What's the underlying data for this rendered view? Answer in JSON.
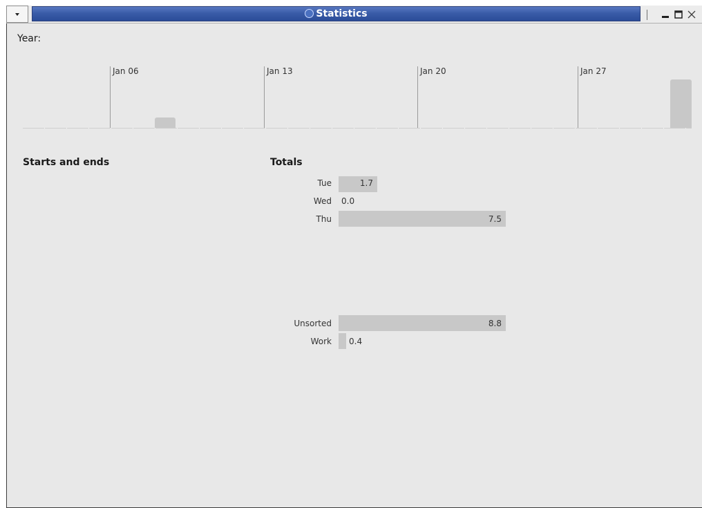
{
  "window": {
    "title": "Statistics"
  },
  "year": {
    "label": "Year:"
  },
  "timeline": {
    "weeks": [
      "Jan 06",
      "Jan 13",
      "Jan 20",
      "Jan 27"
    ]
  },
  "sections": {
    "starts_ends": "Starts and ends",
    "totals": "Totals"
  },
  "totals_days": [
    {
      "label": "Tue",
      "value": "1.7"
    },
    {
      "label": "Wed",
      "value": "0.0"
    },
    {
      "label": "Thu",
      "value": "7.5"
    }
  ],
  "totals_categories": [
    {
      "label": "Unsorted",
      "value": "8.8"
    },
    {
      "label": "Work",
      "value": "0.4"
    }
  ],
  "colors": {
    "titlebar": "#3a5ca8",
    "bar": "#c8c8c8",
    "background": "#e8e8e8"
  },
  "icons": [
    "menu-arrow-icon",
    "app-icon",
    "minimize-icon",
    "maximize-icon",
    "close-icon"
  ]
}
